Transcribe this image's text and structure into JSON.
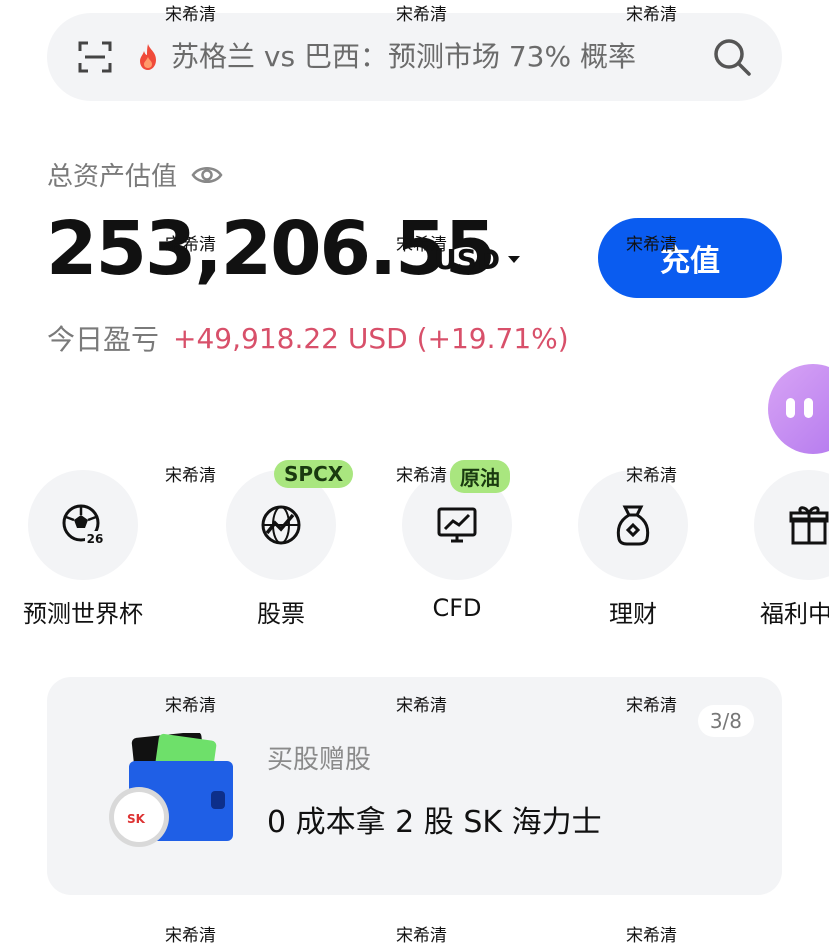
{
  "watermark": {
    "text": "宋希清"
  },
  "search": {
    "query": "苏格兰 vs 巴西：预测市场 73% 概率"
  },
  "assets": {
    "label": "总资产估值",
    "amount": "253,206.55",
    "currency": "USD",
    "deposit_label": "充值",
    "pnl_label": "今日盈亏",
    "pnl_value": "+49,918.22 USD (+19.71%)"
  },
  "quick_menu": [
    {
      "label": "预测世界杯",
      "icon": "soccer-ball-icon",
      "badge": ""
    },
    {
      "label": "股票",
      "icon": "globe-chart-icon",
      "badge": "SPCX"
    },
    {
      "label": "CFD",
      "icon": "monitor-chart-icon",
      "badge": "原油"
    },
    {
      "label": "理财",
      "icon": "money-bag-icon",
      "badge": ""
    },
    {
      "label": "福利中心",
      "icon": "gift-icon",
      "badge": ""
    }
  ],
  "promo": {
    "page": "3/8",
    "subtitle": "买股赠股",
    "title": "0 成本拿 2 股 SK 海力士"
  },
  "colors": {
    "accent": "#0a5cf0",
    "profit": "#d8506a",
    "badge": "#a9e67f"
  }
}
